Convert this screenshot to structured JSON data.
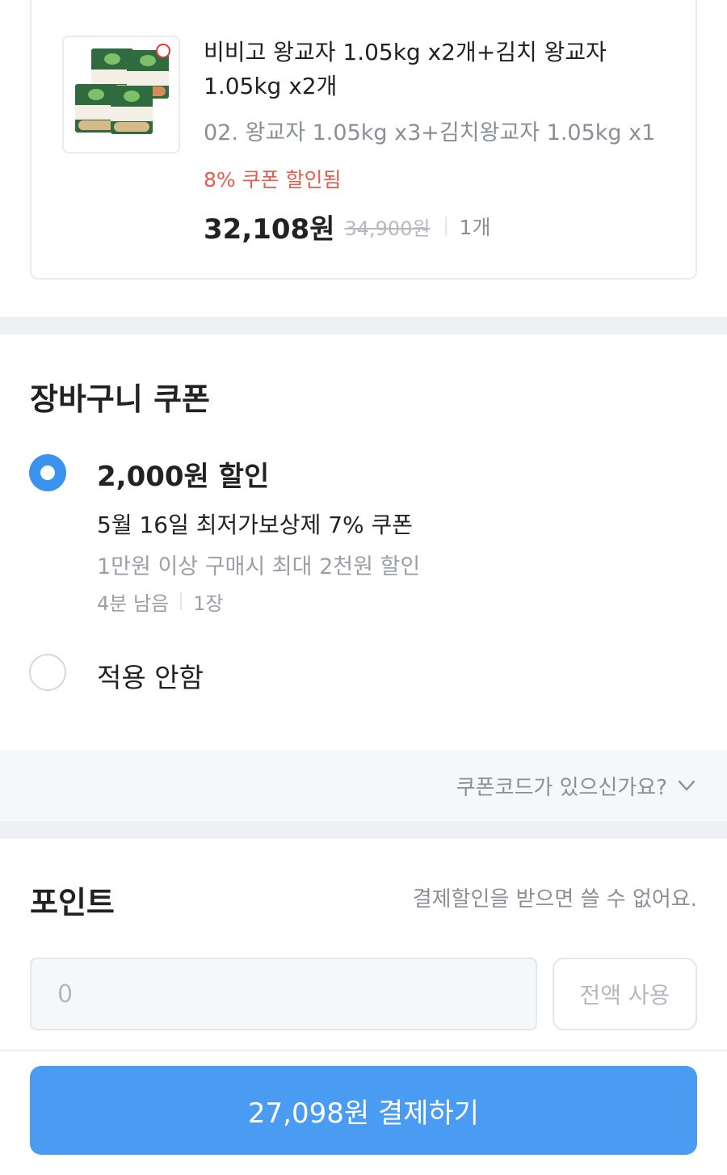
{
  "product": {
    "title": "비비고 왕교자 1.05kg x2개+김치 왕교자 1.05kg x2개",
    "option": "02. 왕교자 1.05kg x3+김치왕교자 1.05kg x1",
    "coupon_applied": "8% 쿠폰 할인됨",
    "price": "32,108원",
    "original_price": "34,900원",
    "quantity": "1개",
    "thumbnail_labels": [
      "김치",
      "왕교자",
      "왕교자"
    ]
  },
  "cart_coupon": {
    "title": "장바구니 쿠폰",
    "options": [
      {
        "amount": "2,000원 할인",
        "name": "5월 16일 최저가보상제 7% 쿠폰",
        "condition": "1만원 이상 구매시 최대 2천원 할인",
        "remaining_time": "4분 남음",
        "count": "1장",
        "selected": true
      },
      {
        "label": "적용 안함",
        "selected": false
      }
    ],
    "code_prompt": "쿠폰코드가 있으신가요?"
  },
  "points": {
    "title": "포인트",
    "note": "결제할인을 받으면 쓸 수 없어요.",
    "placeholder": "0",
    "use_all_label": "전액 사용"
  },
  "payment": {
    "button_label": "27,098원 결제하기"
  },
  "colors": {
    "accent": "#4a9cf2",
    "radio_selected": "#3b93f0",
    "coupon_text": "#e25d4e",
    "muted_text": "#8a8f96",
    "section_band": "#eef0f3"
  },
  "icons": {
    "coupon_code_toggle": "chevron-down-icon",
    "selected_option": "radio-checked-icon",
    "unselected_option": "radio-unchecked-icon"
  }
}
